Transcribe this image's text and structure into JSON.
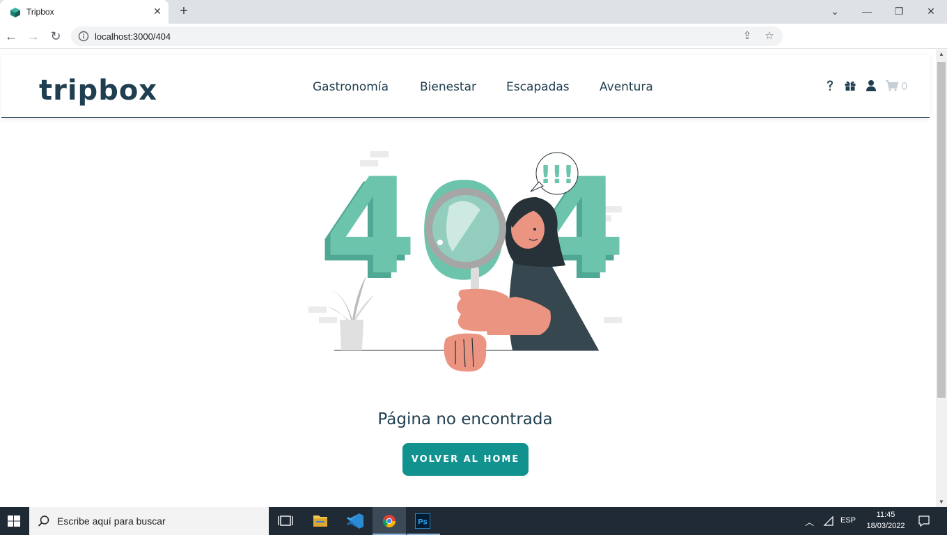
{
  "browser": {
    "tab_title": "Tripbox",
    "tab_close": "✕",
    "new_tab": "+",
    "url": "localhost:3000/404",
    "window_controls": [
      "⌄",
      "—",
      "❐",
      "✕"
    ]
  },
  "header": {
    "logo": "tripbox",
    "menu": [
      "Gastronomía",
      "Bienestar",
      "Escapadas",
      "Aventura"
    ],
    "cart_count": "0",
    "icons": [
      "question-icon",
      "gift-icon",
      "user-icon",
      "cart-icon"
    ]
  },
  "illustration": {
    "speech_bubble_text": "!!!",
    "digits": [
      "4",
      "0",
      "4"
    ]
  },
  "main": {
    "message": "Página no encontrada",
    "button_label": "VOLVER AL HOME"
  },
  "taskbar": {
    "search_placeholder": "Escribe aquí para buscar",
    "language": "ESP",
    "time": "11:45",
    "date": "18/03/2022"
  },
  "colors": {
    "brand_dark": "#1f3e4f",
    "accent": "#12928f",
    "illustration_teal": "#6cc4ad"
  }
}
